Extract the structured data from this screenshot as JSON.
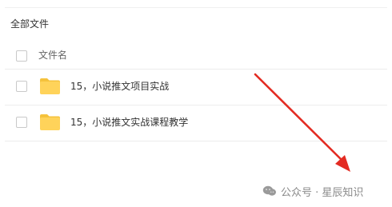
{
  "breadcrumb": "全部文件",
  "table": {
    "header_label": "文件名",
    "rows": [
      {
        "name": "15，小说推文项目实战",
        "icon": "folder-icon"
      },
      {
        "name": "15，小说推文实战课程教学",
        "icon": "folder-icon"
      }
    ]
  },
  "watermark": {
    "text": "公众号 · 星辰知识",
    "icon": "wechat-icon"
  },
  "colors": {
    "folder": "#ffd35a",
    "folder_tab": "#f5c23c",
    "arrow": "#e32b22"
  }
}
